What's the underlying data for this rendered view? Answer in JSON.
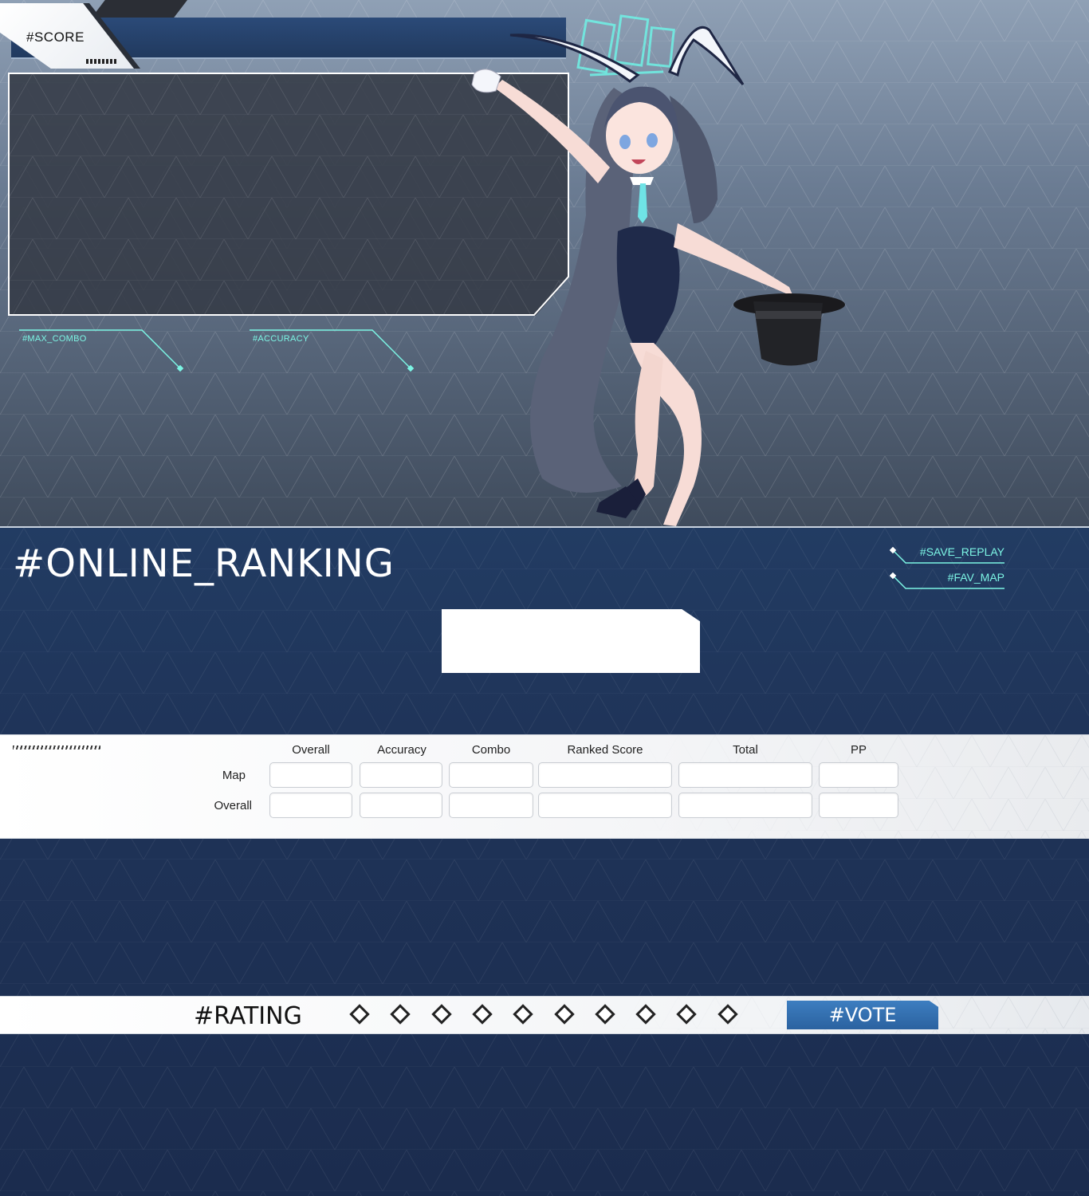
{
  "score": {
    "label": "#SCORE",
    "max_combo_label": "#MAX_COMBO",
    "accuracy_label": "#ACCURACY"
  },
  "online_ranking": {
    "title": "#ONLINE_RANKING",
    "save_replay": "#SAVE_REPLAY",
    "fav_map": "#FAV_MAP"
  },
  "stats": {
    "columns": [
      "Overall",
      "Accuracy",
      "Combo",
      "Ranked Score",
      "Total",
      "PP"
    ],
    "rows": [
      "Map",
      "Overall"
    ]
  },
  "rating": {
    "label": "#RATING",
    "star_count": 10,
    "vote_label": "#VOTE"
  },
  "colors": {
    "accent_cyan": "#7cf5e4",
    "panel_navy": "#223c63",
    "vote_blue": "#3d7ec0"
  },
  "icons": {
    "rating_star": "diamond-outline-icon"
  }
}
